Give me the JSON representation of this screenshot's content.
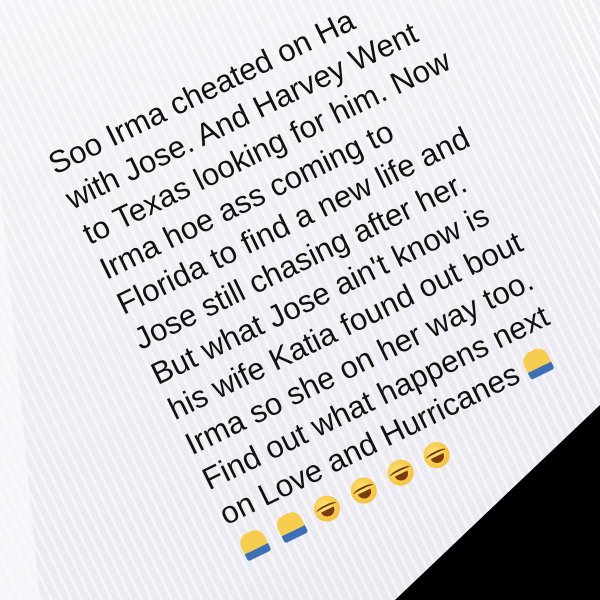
{
  "message": {
    "lines": [
      "Soo Irma cheated on Ha",
      "with Jose. And Harvey Went",
      "to Texas looking for him. Now",
      "Irma hoe ass coming to",
      "Florida to find a new life and",
      "Jose still chasing after her.",
      "But what Jose ain't know is",
      "his wife Katia found out bout",
      "Irma so she on her way too.",
      "Find out what happens next",
      "on Love and Hurricanes"
    ],
    "emoji": [
      "face-palm-emoji",
      "tears-of-joy-emoji"
    ],
    "colors": {
      "bubble": "#ececf2",
      "text": "#111111",
      "emoji": "#f2b51f"
    }
  }
}
